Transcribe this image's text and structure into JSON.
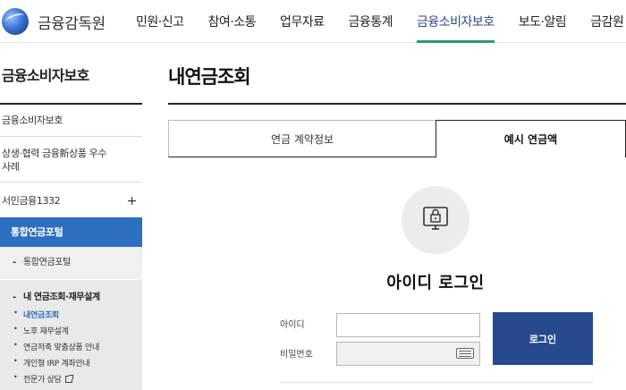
{
  "header": {
    "logo_text": "금융감독원",
    "nav": [
      "민원·신고",
      "참여·소통",
      "업무자료",
      "금융통계",
      "금융소비자보호",
      "보도·알림",
      "금감원"
    ],
    "active_nav": "금융소비자보호",
    "accent": "#2d9a6c"
  },
  "sidebar": {
    "title": "금융소비자보호",
    "items": [
      {
        "label": "금융소비자보호"
      },
      {
        "label": "상생·협력 금융新상품 우수사례"
      },
      {
        "label": "서민금융1332",
        "expand": "+"
      },
      {
        "label": "통합연금포털"
      },
      {
        "label": "통합연금포털"
      },
      {
        "label": "내 연금조회·재무설계"
      }
    ],
    "sub_items": [
      {
        "label": "내연금조회"
      },
      {
        "label": "노후 재무설계"
      },
      {
        "label": "연금저축 맞춤상품 안내"
      },
      {
        "label": "개인형 IRP 계좌안내"
      },
      {
        "label": "전문가 상담"
      }
    ],
    "active_color": "#2d6fc1"
  },
  "main": {
    "title": "내연금조회",
    "tabs": [
      {
        "label": "연금 계약정보"
      },
      {
        "label": "예시 연금액"
      }
    ],
    "login": {
      "title": "아이디 로그인",
      "id_label": "아이디",
      "pw_label": "비밀번호",
      "id_value": "",
      "pw_value": "",
      "button": "로그인",
      "button_color": "#264a8e"
    }
  }
}
